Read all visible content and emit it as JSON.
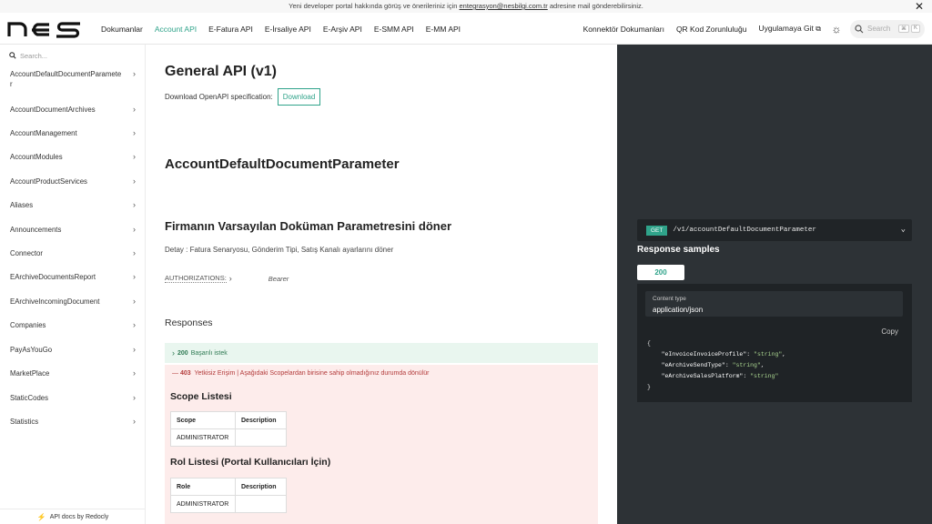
{
  "banner": {
    "text_before": "Yeni developer portal hakkında görüş ve önerileriniz için ",
    "email": "entegrasyon@nesbilgi.com.tr",
    "text_after": " adresine mail gönderebilirsiniz.",
    "close": "✕"
  },
  "nav": {
    "logo": "NES",
    "links": [
      "Dokumanlar",
      "Account API",
      "E-Fatura API",
      "E-İrsaliye API",
      "E-Arşiv API",
      "E-SMM API",
      "E-MM API"
    ],
    "right_links": [
      "Konnektör Dokumanları",
      "QR Kod Zorunluluğu",
      "Uygulamaya Git"
    ],
    "search_placeholder": "Search",
    "kbd1": "⌘",
    "kbd2": "K"
  },
  "sidebar": {
    "search_placeholder": "Search...",
    "items": [
      "AccountDefaultDocumentParameter",
      "AccountDocumentArchives",
      "AccountManagement",
      "AccountModules",
      "AccountProductServices",
      "Aliases",
      "Announcements",
      "Connector",
      "EArchiveDocumentsReport",
      "EArchiveIncomingDocument",
      "Companies",
      "PayAsYouGo",
      "MarketPlace",
      "StaticCodes",
      "Statistics"
    ],
    "footer": "API docs by Redocly"
  },
  "main": {
    "title": "General API (v1)",
    "download_label": "Download OpenAPI specification:",
    "download_button": "Download",
    "section_title": "AccountDefaultDocumentParameter",
    "operation_title": "Firmanın Varsayılan Doküman Parametresini döner",
    "detail": "Detay : Fatura Senaryosu, Gönderim Tipi, Satış Kanalı ayarlarını döner",
    "auth_label": "AUTHORIZATIONS:",
    "auth_value": "Bearer",
    "responses_title": "Responses",
    "r200_code": "200",
    "r200_text": "Başarılı istek",
    "r403_code": "403",
    "r403_text": "Yetkisiz Erişim | Aşağıdaki Scopelardan birisine sahip olmadığınız durumda dönülür",
    "scope_title": "Scope Listesi",
    "scope_headers": [
      "Scope",
      "Description"
    ],
    "scope_rows": [
      [
        "ADMINISTRATOR",
        ""
      ]
    ],
    "role_title": "Rol Listesi (Portal Kullanıcıları İçin)",
    "role_headers": [
      "Role",
      "Description"
    ],
    "role_rows": [
      [
        "ADMINISTRATOR",
        ""
      ]
    ]
  },
  "panel": {
    "method": "GET",
    "path": "/v1/accountDefaultDocumentParameter",
    "samples_title": "Response samples",
    "tab": "200",
    "content_type_label": "Content type",
    "content_type": "application/json",
    "copy": "Copy",
    "code": {
      "k1": "\"eInvoiceInvoiceProfile\"",
      "v1": "\"string\"",
      "k2": "\"eArchiveSendType\"",
      "v2": "\"string\"",
      "k3": "\"eArchiveSalesPlatform\"",
      "v3": "\"string\""
    }
  }
}
